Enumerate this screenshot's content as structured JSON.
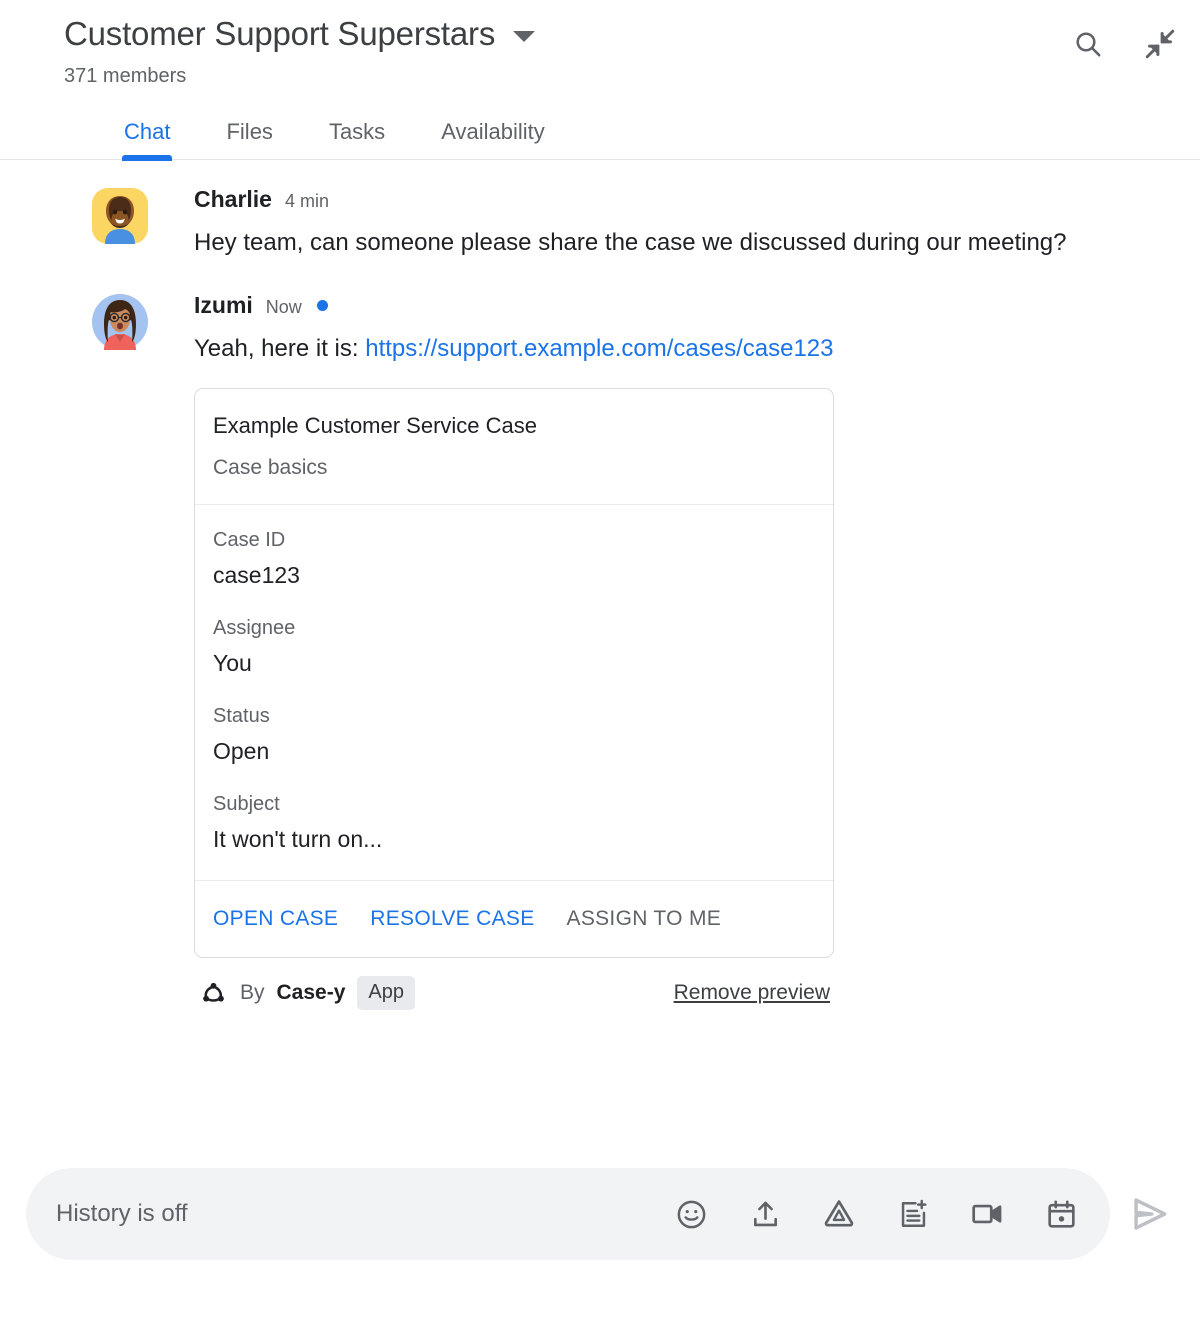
{
  "header": {
    "room_title": "Customer Support Superstars",
    "member_count": "371 members",
    "dropdown_icon": "chevron-down-icon",
    "search_icon": "search-icon",
    "collapse_icon": "collapse-icon"
  },
  "tabs": [
    {
      "label": "Chat",
      "active": true
    },
    {
      "label": "Files",
      "active": false
    },
    {
      "label": "Tasks",
      "active": false
    },
    {
      "label": "Availability",
      "active": false
    }
  ],
  "messages": [
    {
      "sender": "Charlie",
      "time": "4 min",
      "unread": false,
      "text": "Hey team, can someone please share the case we discussed during our meeting?",
      "avatar": "charlie-avatar"
    },
    {
      "sender": "Izumi",
      "time": "Now",
      "unread": true,
      "text_prefix": "Yeah, here it is: ",
      "link_text": "https://support.example.com/cases/case123",
      "avatar": "izumi-avatar"
    }
  ],
  "card": {
    "title": "Example Customer Service Case",
    "subtitle": "Case basics",
    "fields": [
      {
        "label": "Case ID",
        "value": "case123"
      },
      {
        "label": "Assignee",
        "value": "You"
      },
      {
        "label": "Status",
        "value": "Open"
      },
      {
        "label": "Subject",
        "value": "It won't turn on..."
      }
    ],
    "actions": [
      {
        "label": "OPEN CASE",
        "disabled": false
      },
      {
        "label": "RESOLVE CASE",
        "disabled": false
      },
      {
        "label": "ASSIGN TO ME",
        "disabled": true
      }
    ]
  },
  "attribution": {
    "icon": "webhook-icon",
    "by_text": "By",
    "app_name": "Case-y",
    "badge": "App",
    "remove_preview": "Remove preview"
  },
  "compose": {
    "placeholder": "History is off",
    "icons": [
      "emoji-icon",
      "upload-icon",
      "drive-icon",
      "add-document-icon",
      "video-call-icon",
      "calendar-icon"
    ],
    "send_icon": "send-icon"
  },
  "colors": {
    "accent": "#1a73e8",
    "text_primary": "#202124",
    "text_secondary": "#5f6368",
    "border": "#dadce0",
    "compose_bg": "#f1f3f4",
    "badge_bg": "#e8eaed",
    "send_disabled": "#bdc1c6"
  }
}
